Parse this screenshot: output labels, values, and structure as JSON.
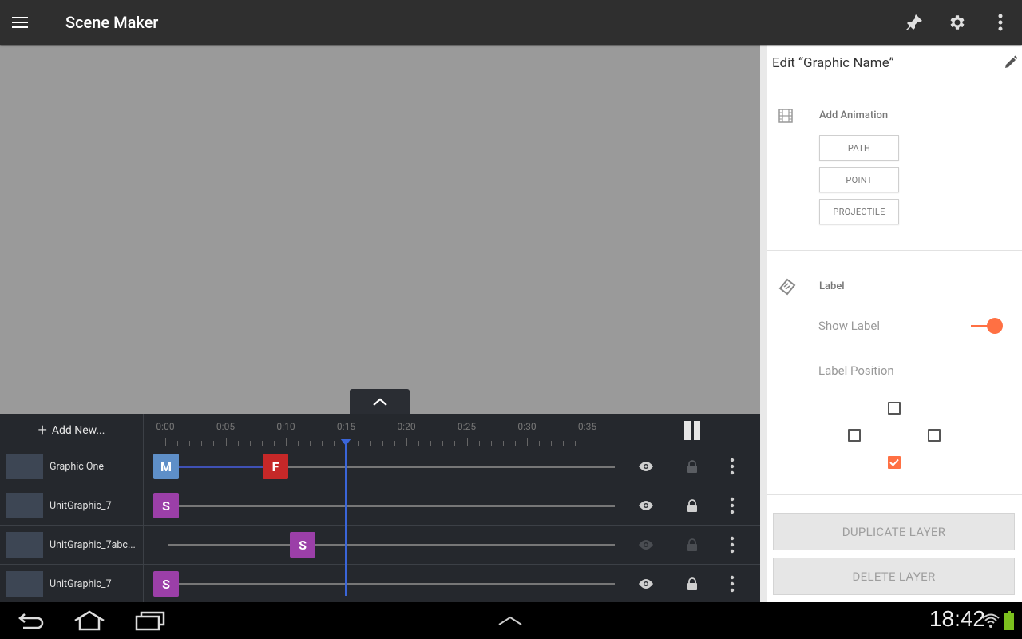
{
  "app": {
    "title": "Scene Maker",
    "menu_icon": "hamburger-menu-icon",
    "actions": [
      "pin-icon",
      "gear-icon",
      "more-vert-icon"
    ]
  },
  "timeline": {
    "add_new_label": "Add New...",
    "tick_labels": [
      "0:00",
      "0:05",
      "0:10",
      "0:15",
      "0:20",
      "0:25",
      "0:30",
      "0:35"
    ],
    "play_state": "pause",
    "playhead_time": "0:15",
    "rows": [
      {
        "name": "Graphic One",
        "keyframes": [
          "M",
          "F"
        ],
        "visible": true,
        "locked": false
      },
      {
        "name": "UnitGraphic_7",
        "keyframes": [
          "S"
        ],
        "visible": true,
        "locked": true
      },
      {
        "name": "UnitGraphic_7abc...",
        "keyframes": [
          "S"
        ],
        "visible": false,
        "locked": false
      },
      {
        "name": "UnitGraphic_7",
        "keyframes": [
          "S"
        ],
        "visible": true,
        "locked": true
      }
    ]
  },
  "panel": {
    "title": "Edit “Graphic Name”",
    "animation_section": {
      "title": "Add Animation",
      "buttons": [
        "PATH",
        "POINT",
        "PROJECTILE"
      ]
    },
    "label_section": {
      "title": "Label",
      "show_label": "Show Label",
      "show_label_on": true,
      "label_position": "Label Position",
      "selected_position": "bottom"
    },
    "duplicate_button": "DUPLICATE LAYER",
    "delete_button": "DELETE LAYER"
  },
  "system": {
    "time": "18:42"
  },
  "colors": {
    "accent": "#ff7043",
    "playhead": "#3a65d8",
    "kf_m": "#5e8fc8",
    "kf_f": "#c62828",
    "kf_s": "#9b3fa8"
  }
}
